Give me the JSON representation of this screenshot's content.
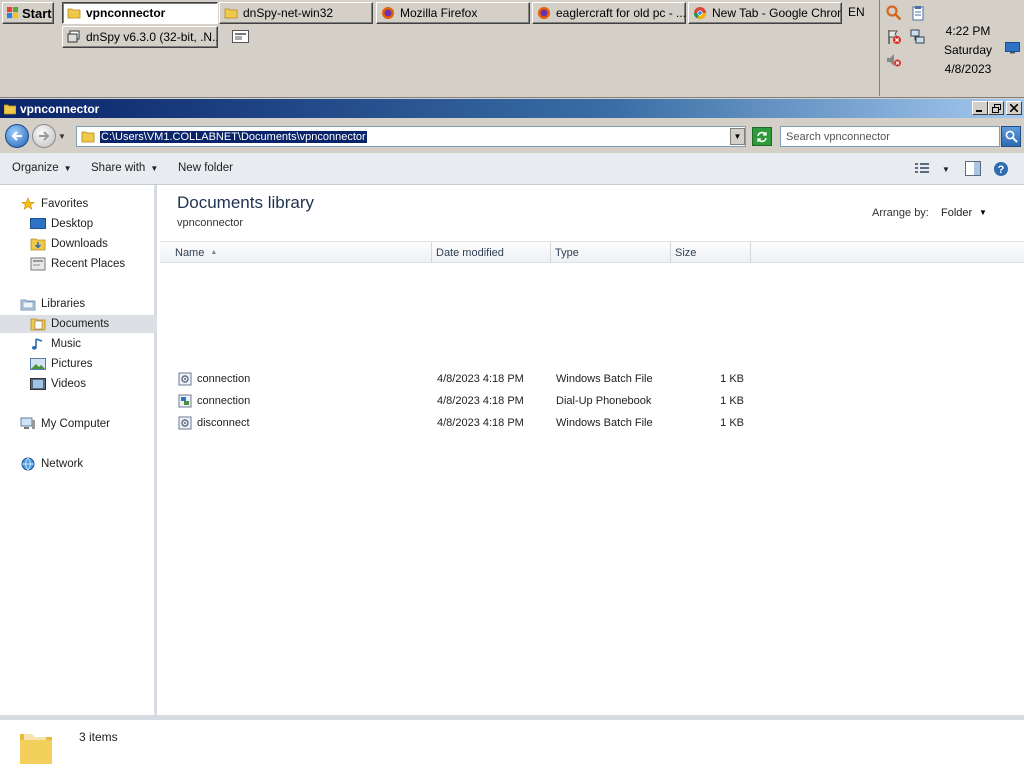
{
  "taskbar": {
    "start_label": "Start",
    "buttons": [
      {
        "label": "vpnconnector",
        "icon": "folder-icon",
        "active": true
      },
      {
        "label": "dnSpy-net-win32",
        "icon": "folder-icon",
        "active": false
      },
      {
        "label": "Mozilla Firefox",
        "icon": "firefox-icon",
        "active": false
      },
      {
        "label": "eaglercraft for old pc - ...",
        "icon": "firefox-icon",
        "active": false
      },
      {
        "label": "New Tab - Google Chrome",
        "icon": "chrome-icon",
        "active": false
      },
      {
        "label": "dnSpy v6.3.0 (32-bit, .N...",
        "icon": "window-icon",
        "active": false
      }
    ],
    "language": "EN",
    "clock": {
      "time": "4:22 PM",
      "day": "Saturday",
      "date": "4/8/2023"
    }
  },
  "window": {
    "title": "vpnconnector",
    "address": "C:\\Users\\VM1.COLLABNET\\Documents\\vpnconnector",
    "search_placeholder": "Search vpnconnector"
  },
  "toolbar": {
    "organize": "Organize",
    "share_with": "Share with",
    "new_folder": "New folder"
  },
  "nav": {
    "favorites": "Favorites",
    "desktop": "Desktop",
    "downloads": "Downloads",
    "recent_places": "Recent Places",
    "libraries": "Libraries",
    "documents": "Documents",
    "music": "Music",
    "pictures": "Pictures",
    "videos": "Videos",
    "my_computer": "My Computer",
    "network": "Network"
  },
  "content": {
    "library_title": "Documents library",
    "library_subtitle": "vpnconnector",
    "arrange_by_label": "Arrange by:",
    "arrange_by_value": "Folder",
    "columns": {
      "name": "Name",
      "date_modified": "Date modified",
      "type": "Type",
      "size": "Size"
    },
    "files": [
      {
        "name": "connection",
        "date": "4/8/2023 4:18 PM",
        "type": "Windows Batch File",
        "size": "1 KB",
        "icon": "batch-file-icon"
      },
      {
        "name": "connection",
        "date": "4/8/2023 4:18 PM",
        "type": "Dial-Up Phonebook",
        "size": "1 KB",
        "icon": "phonebook-icon"
      },
      {
        "name": "disconnect",
        "date": "4/8/2023 4:18 PM",
        "type": "Windows Batch File",
        "size": "1 KB",
        "icon": "batch-file-icon"
      }
    ]
  },
  "status": {
    "item_count": "3 items"
  },
  "colors": {
    "titlebar": "#0a246a",
    "selection": "#0a246a",
    "refresh": "#2f9a3a"
  }
}
